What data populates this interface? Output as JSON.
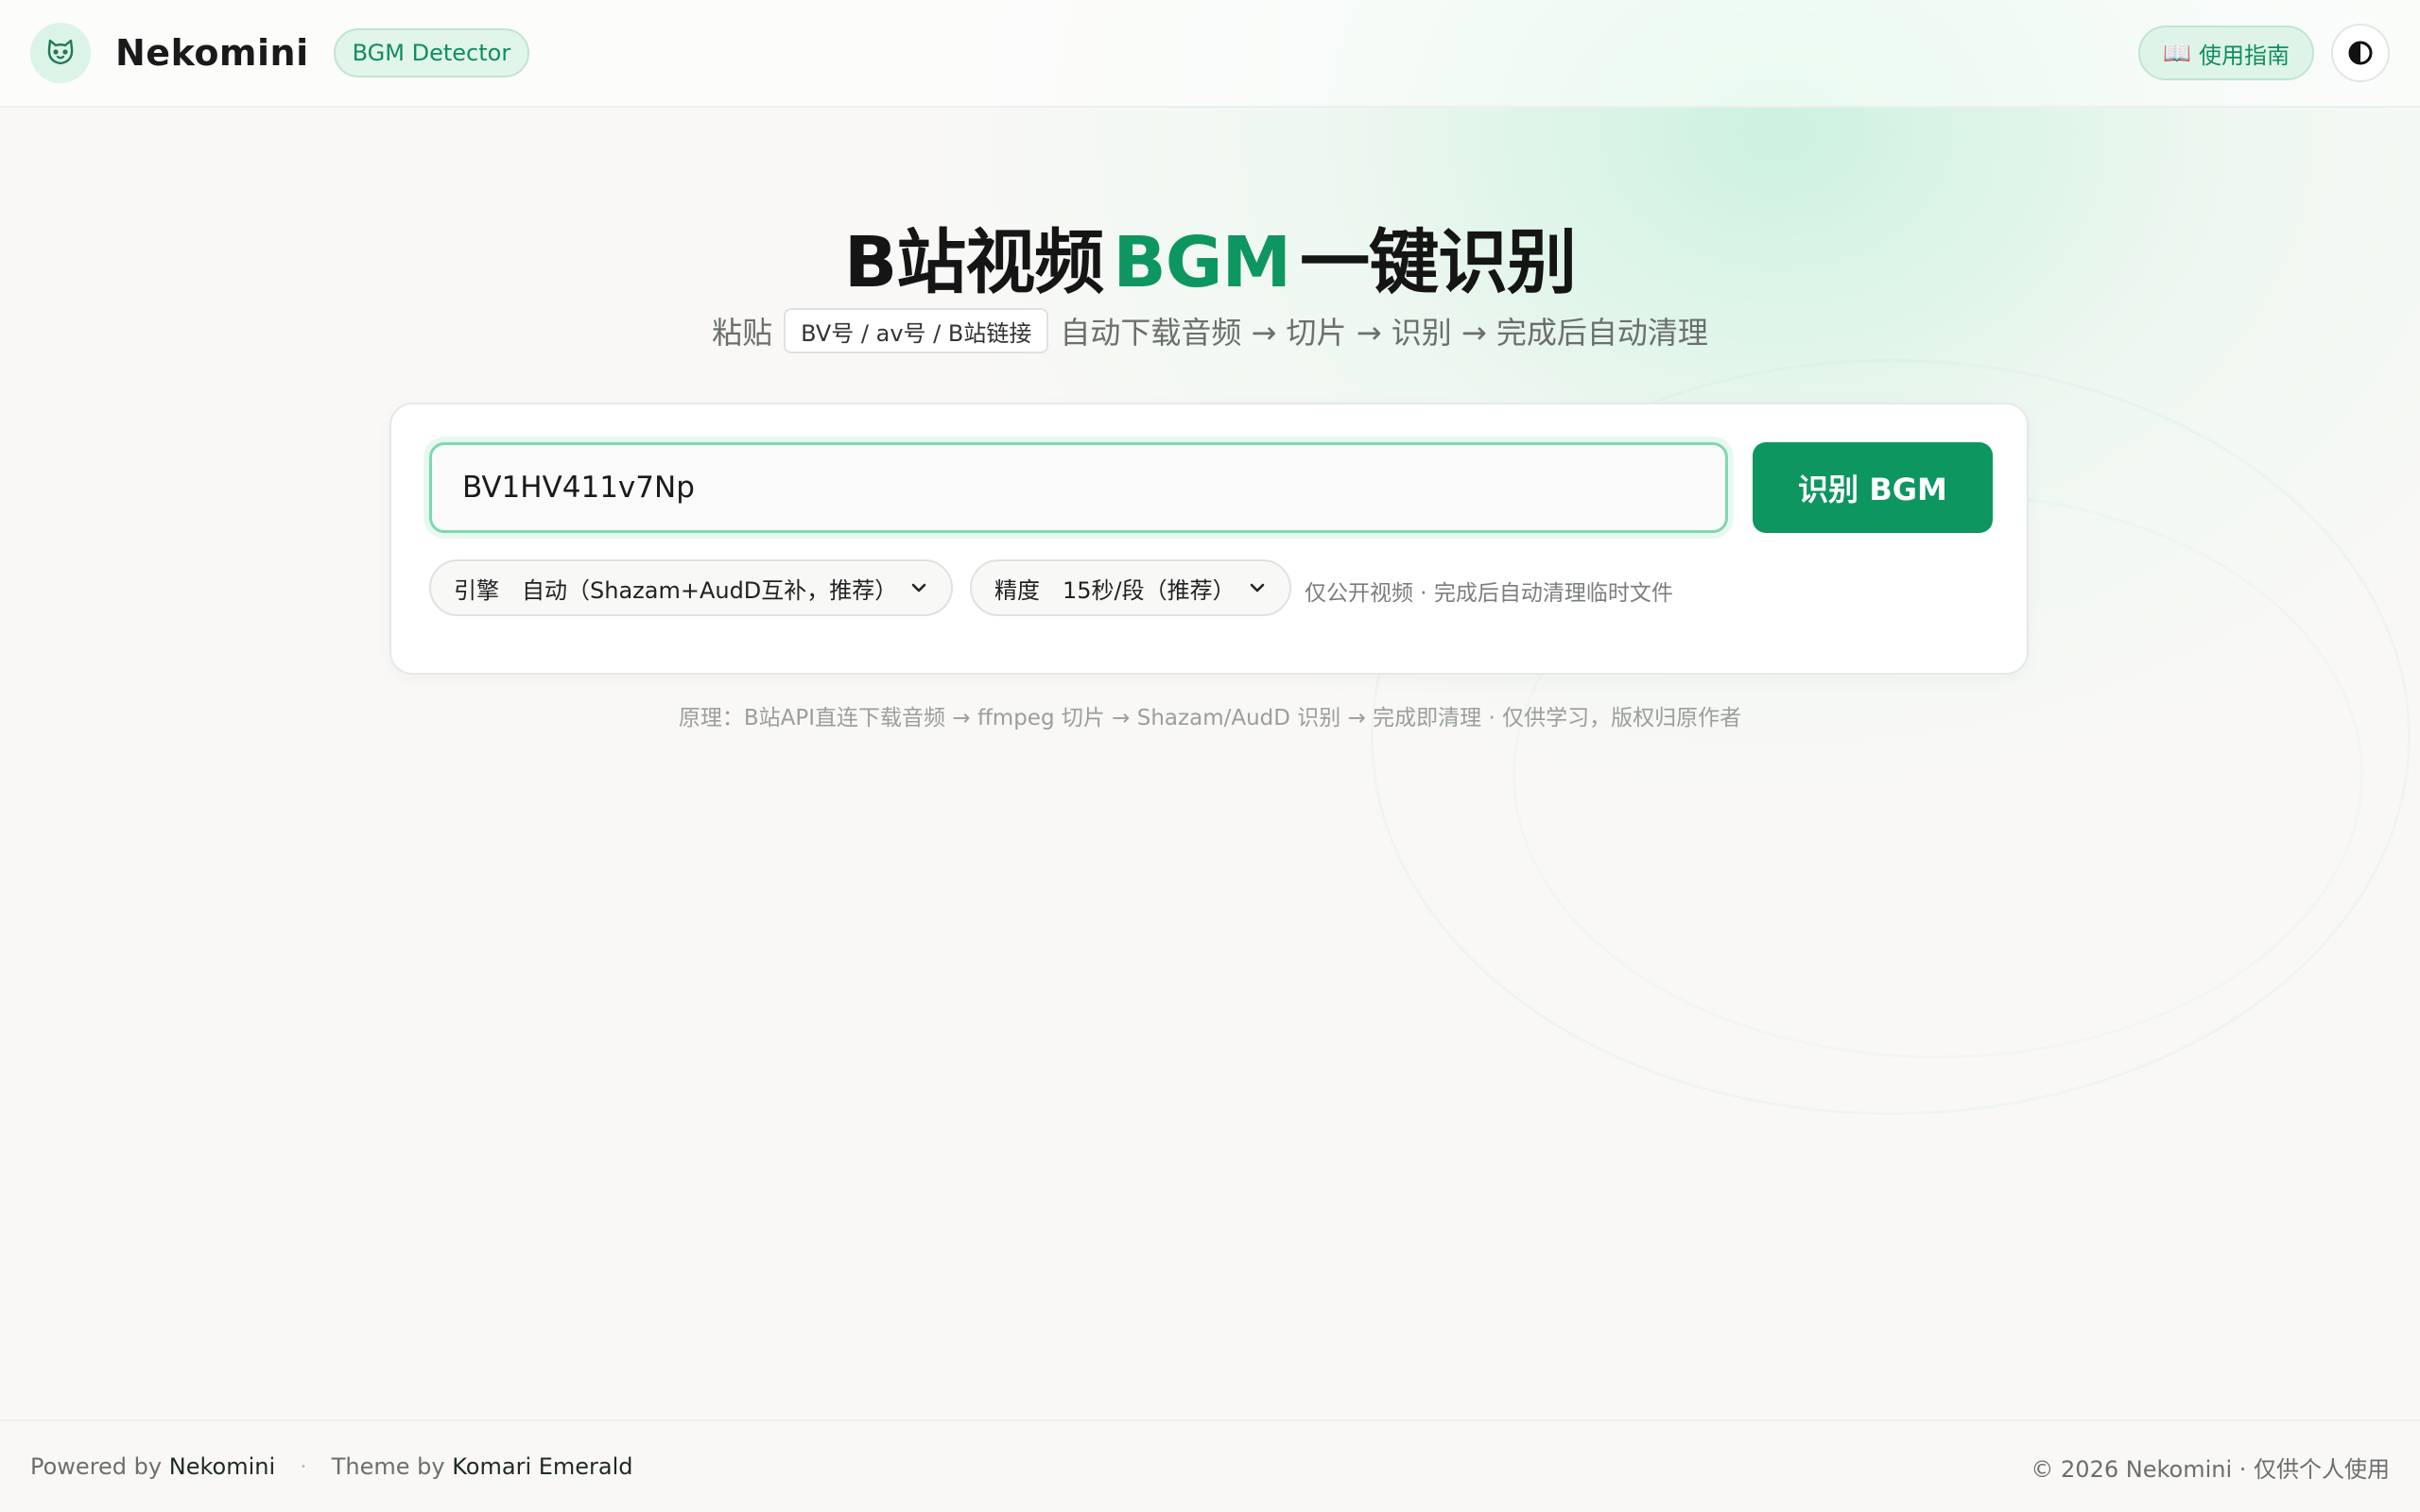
{
  "header": {
    "logo_icon": "cat-face-icon",
    "brand": "Nekomini",
    "badge": "BGM Detector",
    "guide_button": {
      "icon": "book-icon",
      "glyph": "📖",
      "label": "使用指南"
    },
    "theme_toggle_icon": "contrast-icon"
  },
  "hero": {
    "title_prefix": "B站视频",
    "title_accent": "BGM",
    "title_suffix": "一键识别",
    "sub_prefix": "粘贴",
    "sub_chip": "BV号 / av号 / B站链接",
    "sub_suffix": "自动下载音频 → 切片 → 识别 → 完成后自动清理"
  },
  "form": {
    "input_value": "BV1HV411v7Np",
    "submit_label": "识别 BGM",
    "engine": {
      "label": "引擎",
      "value": "自动（Shazam+AudD互补，推荐）"
    },
    "precision": {
      "label": "精度",
      "value": "15秒/段（推荐）"
    },
    "note": "仅公开视频 · 完成后自动清理临时文件"
  },
  "principle": "原理：B站API直连下载音频 → ffmpeg 切片 → Shazam/AudD 识别 → 完成即清理 · 仅供学习，版权归原作者",
  "footer": {
    "powered_prefix": "Powered by",
    "powered_name": "Nekomini",
    "separator": "·",
    "theme_prefix": "Theme by",
    "theme_name": "Komari Emerald",
    "copyright": "© 2026 Nekomini · 仅供个人使用"
  },
  "colors": {
    "accent": "#0e9660",
    "accent_light": "#dff4e8",
    "input_border": "#7ed9ae",
    "background": "#f9f8f6"
  }
}
